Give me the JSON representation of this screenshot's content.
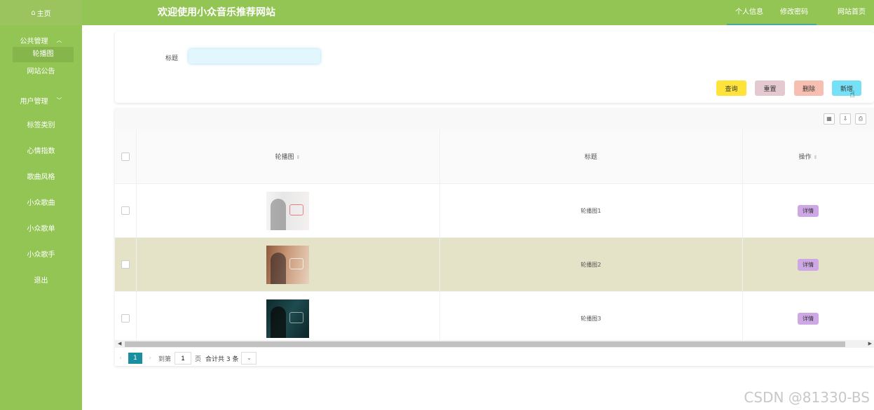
{
  "topbar": {
    "home_label": "主页",
    "site_title": "欢迎使用小众音乐推荐网站",
    "nav": [
      "个人信息",
      "修改密码",
      "网站首页"
    ]
  },
  "sidebar": {
    "group_public": "公共管理",
    "sub_carousel": "轮播图",
    "sub_notice": "网站公告",
    "group_user": "用户管理",
    "items": [
      "标签类别",
      "心情指数",
      "歌曲风格",
      "小众歌曲",
      "小众歌单",
      "小众歌手",
      "退出"
    ]
  },
  "search": {
    "title_label": "标题",
    "title_value": "",
    "buttons": {
      "query": "查询",
      "reset": "重置",
      "delete": "删除",
      "add": "新增"
    }
  },
  "table": {
    "columns": [
      "轮播图",
      "标题",
      "操作"
    ],
    "rows": [
      {
        "title": "轮播图1",
        "action": "详情"
      },
      {
        "title": "轮播图2",
        "action": "详情"
      },
      {
        "title": "轮播图3",
        "action": "详情"
      }
    ],
    "highlighted_row": 2
  },
  "pagination": {
    "current": "1",
    "goto_label": "到第",
    "goto_value": "1",
    "page_label": "页",
    "total_label": "合计共 3 条"
  },
  "watermark": "CSDN @81330-BS",
  "colors": {
    "primary": "#93c554",
    "query": "#ffe23a",
    "reset": "#e5c9d0",
    "delete": "#f7bfb1",
    "add": "#76e1f6",
    "detail": "#cda8e4"
  }
}
